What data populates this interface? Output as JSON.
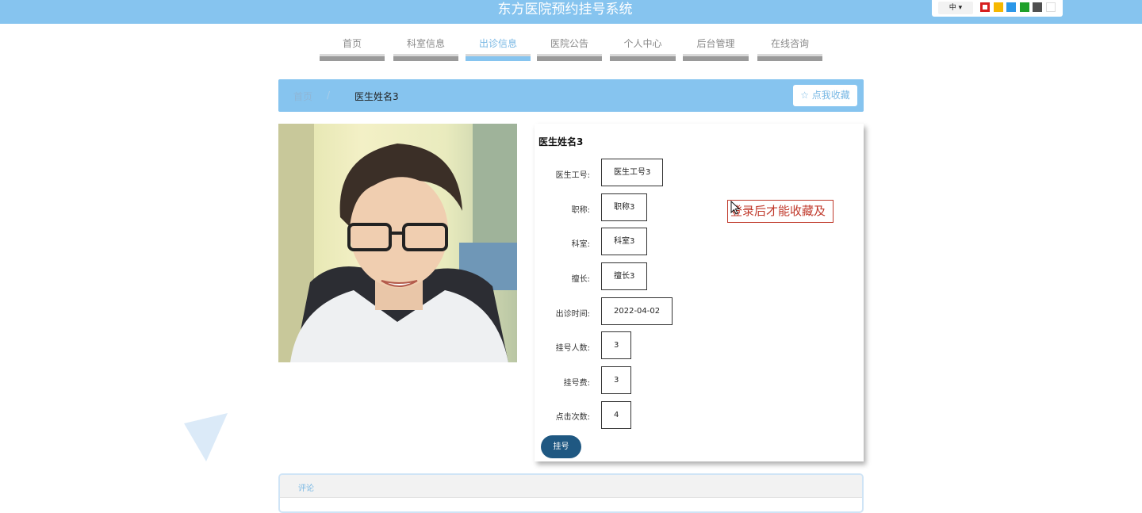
{
  "header": {
    "site_title": "东方医院预约挂号系统",
    "lang_label": "中 ▾",
    "theme_colors": [
      "#d61f1f",
      "#f6b800",
      "#2b97e8",
      "#1ea02a",
      "#505050",
      "#ffffff"
    ]
  },
  "nav": {
    "items": [
      {
        "label": "首页"
      },
      {
        "label": "科室信息"
      },
      {
        "label": "出诊信息"
      },
      {
        "label": "医院公告"
      },
      {
        "label": "个人中心"
      },
      {
        "label": "后台管理"
      },
      {
        "label": "在线咨询"
      }
    ],
    "active": "出诊信息"
  },
  "breadcrumb": {
    "home": "首页",
    "separator": "/",
    "current": "医生姓名3",
    "favorite_label": "☆ 点我收藏"
  },
  "doctor": {
    "name": "医生姓名3",
    "photo_alt": "doctor-photo",
    "fields": [
      {
        "label": "医生工号:",
        "value": "医生工号3"
      },
      {
        "label": "职称:",
        "value": "职称3"
      },
      {
        "label": "科室:",
        "value": "科室3"
      },
      {
        "label": "擅长:",
        "value": "擅长3"
      },
      {
        "label": "出诊时间:",
        "value": "2022-04-02"
      },
      {
        "label": "挂号人数:",
        "value": "3"
      },
      {
        "label": "挂号费:",
        "value": "3"
      },
      {
        "label": "点击次数:",
        "value": "4"
      }
    ],
    "login_notice": "登录后才能收藏及",
    "register_button": "挂号"
  },
  "comments": {
    "title": "评论"
  },
  "colors": {
    "primary": "#86c4ef",
    "button_dark": "#1f5882",
    "notice_red": "#c0392b"
  }
}
